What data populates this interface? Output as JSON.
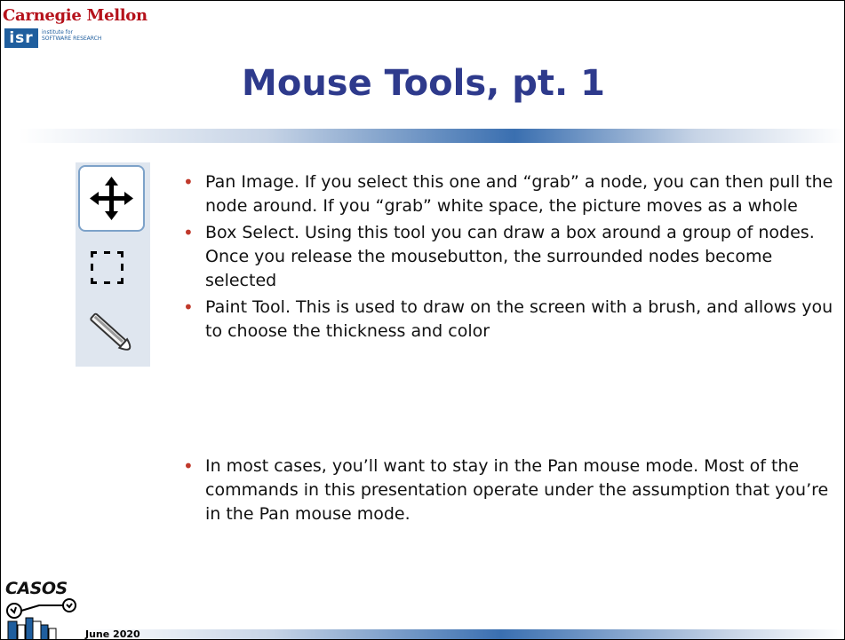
{
  "header": {
    "institution": "Carnegie Mellon",
    "isr_logo": "isr",
    "isr_text": "institute for SOFTWARE RESEARCH"
  },
  "title": "Mouse Tools, pt. 1",
  "tools": [
    {
      "icon": "pan-move-icon",
      "selected": true
    },
    {
      "icon": "box-select-icon",
      "selected": false
    },
    {
      "icon": "paint-brush-icon",
      "selected": false
    }
  ],
  "bullets": [
    "Pan Image.  If you select this one and “grab” a node, you can then pull the node around.  If you “grab” white space, the picture moves as a whole",
    "Box Select.  Using this tool you can draw a box around a group of nodes.  Once you release the mousebutton, the surrounded nodes become selected",
    "Paint Tool.  This is used to draw on the screen with a brush, and allows you to choose the thickness and color"
  ],
  "note": "In most cases, you’ll want to stay in the Pan mouse mode.  Most of the commands in this presentation operate under the assumption that you’re in the Pan mouse mode.",
  "footer": {
    "logo_text": "CASOS",
    "date": "June 2020"
  },
  "colors": {
    "title": "#2e3a8c",
    "bullet": "#c0392b",
    "cmu": "#b5121b",
    "isr": "#1f5e9e"
  }
}
